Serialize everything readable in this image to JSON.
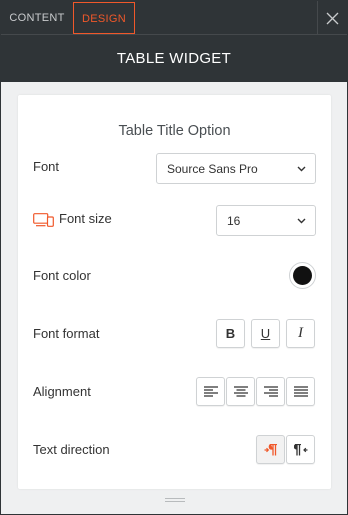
{
  "tabs": {
    "content": "CONTENT",
    "design": "DESIGN"
  },
  "header": {
    "title": "TABLE WIDGET"
  },
  "section": {
    "title": "Table Title Option"
  },
  "font": {
    "label": "Font",
    "value": "Source Sans Pro"
  },
  "font_size": {
    "label": "Font size",
    "value": "16"
  },
  "font_color": {
    "label": "Font color",
    "value": "#111111"
  },
  "font_format": {
    "label": "Font format",
    "bold": "B",
    "underline": "U",
    "italic": "I"
  },
  "alignment": {
    "label": "Alignment",
    "options": [
      "align-left",
      "align-center",
      "align-right",
      "align-justify"
    ]
  },
  "text_direction": {
    "label": "Text direction",
    "selected": "ltr"
  },
  "colors": {
    "accent": "#f0582a",
    "dark": "#2f3437",
    "background": "#eff0f1"
  }
}
